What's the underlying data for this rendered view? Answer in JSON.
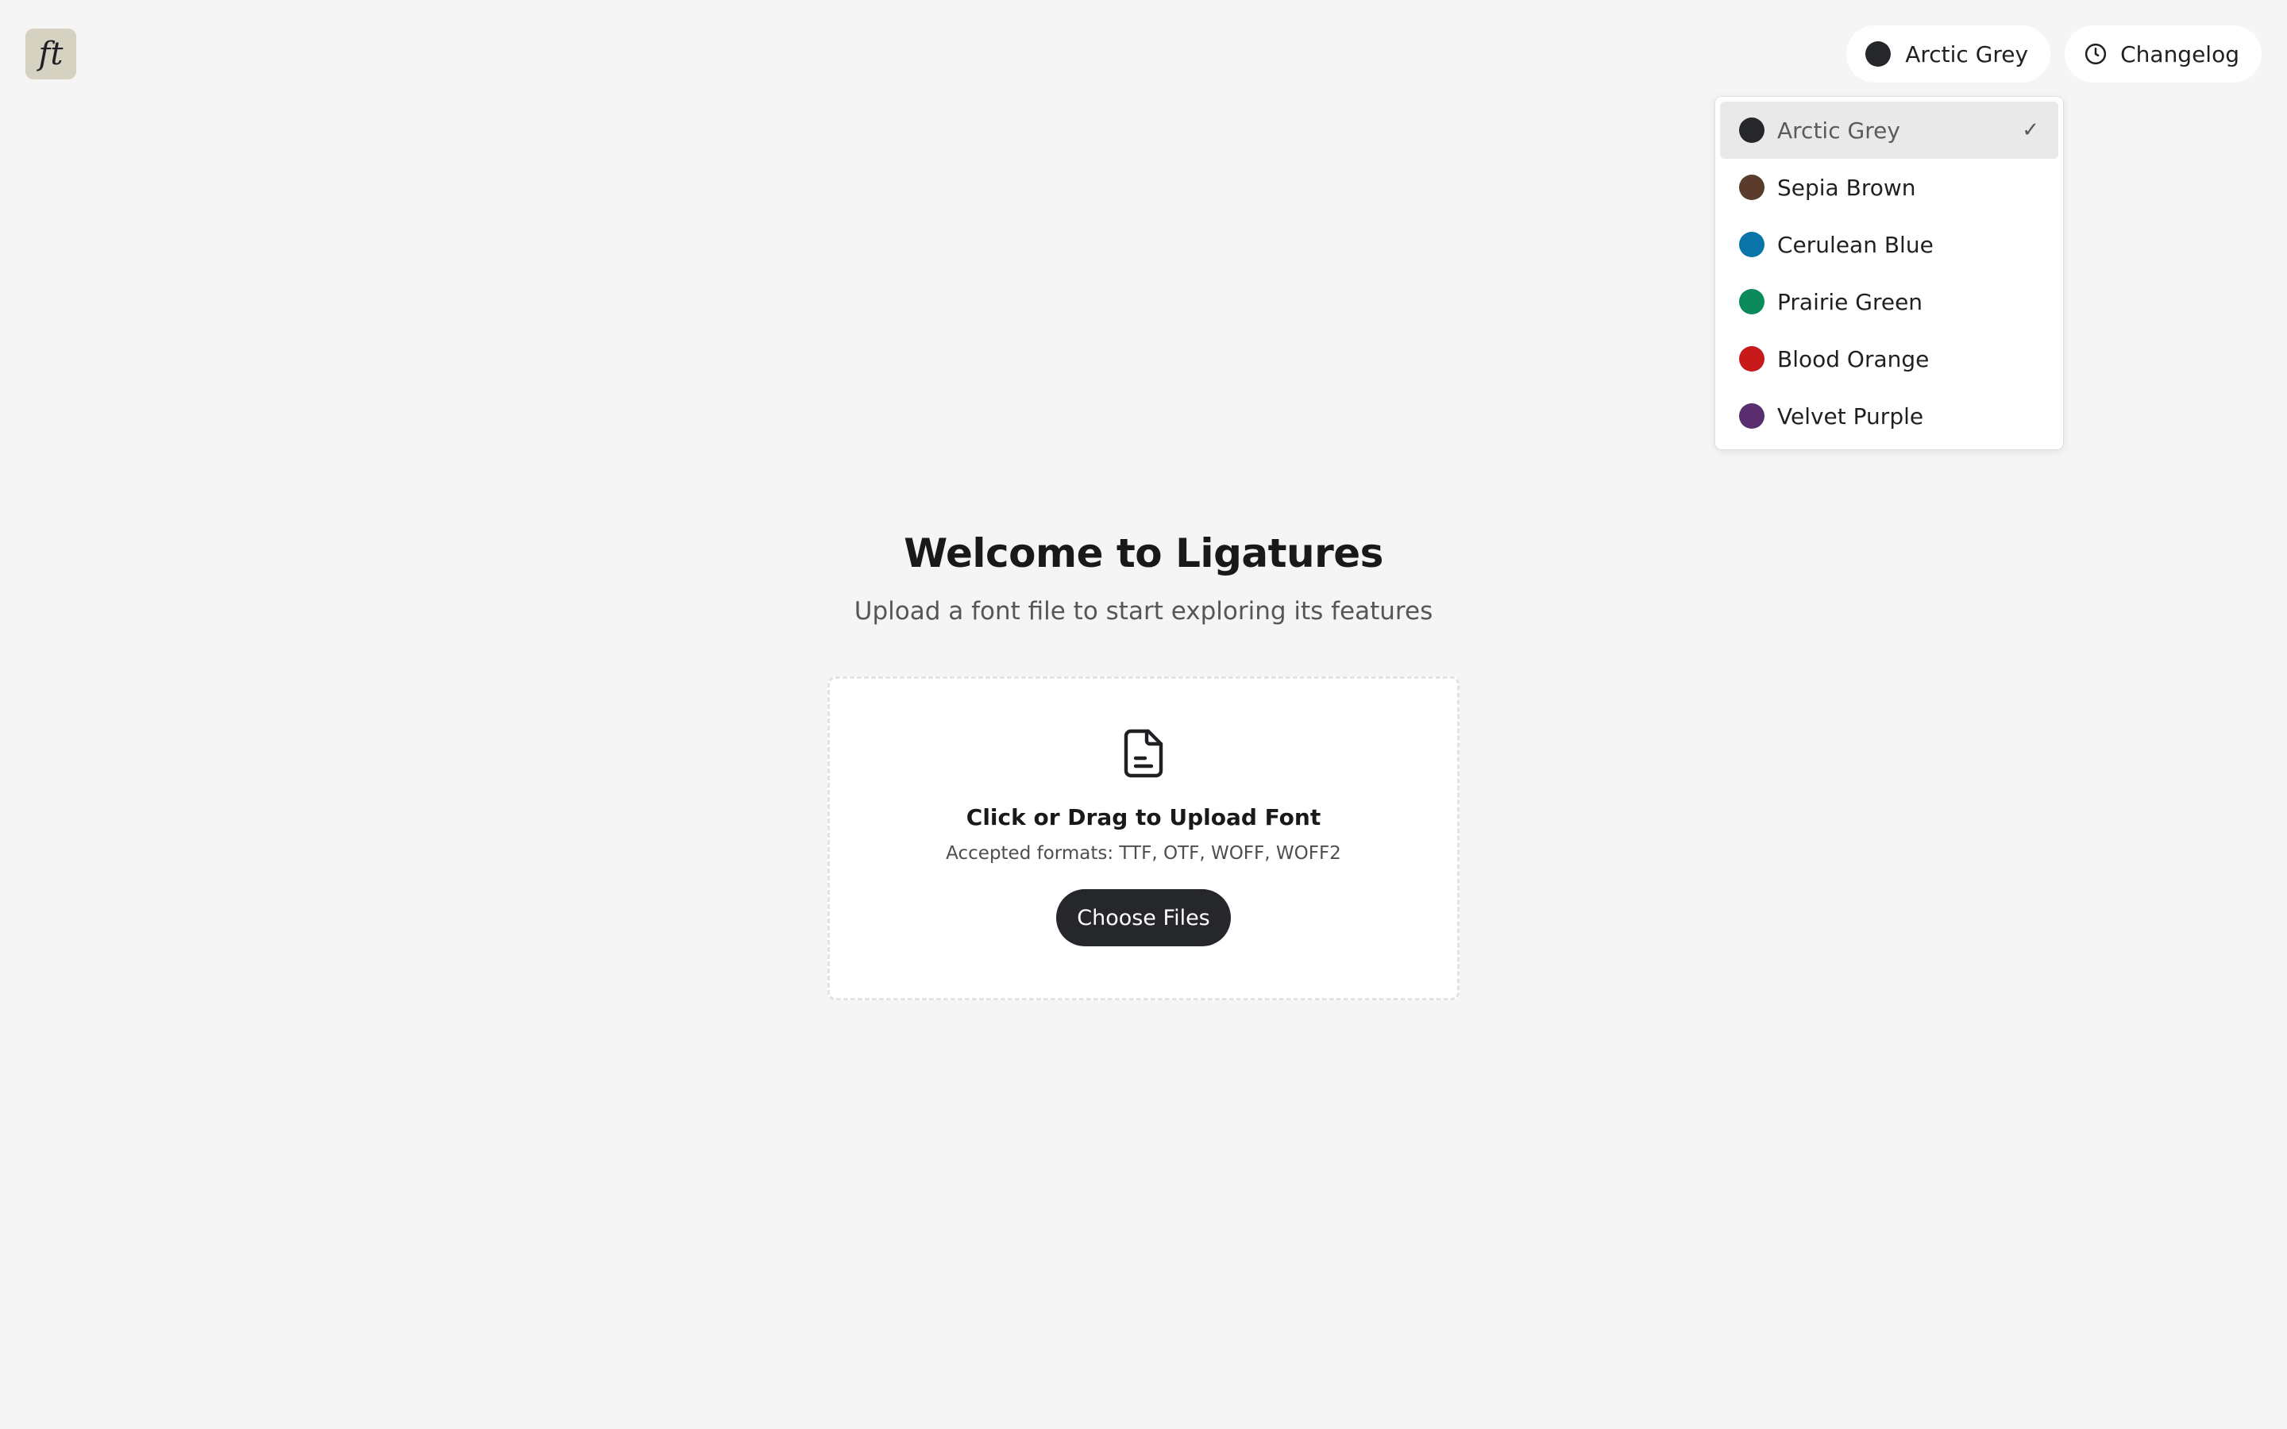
{
  "app": {
    "logo_text": "ft"
  },
  "header": {
    "theme_button_label": "Arctic Grey",
    "theme_button_color": "#26272a",
    "changelog_label": "Changelog"
  },
  "theme_menu": {
    "items": [
      {
        "label": "Arctic Grey",
        "color": "#26272a",
        "selected": true
      },
      {
        "label": "Sepia Brown",
        "color": "#5b3b2b",
        "selected": false
      },
      {
        "label": "Cerulean Blue",
        "color": "#0a74a8",
        "selected": false
      },
      {
        "label": "Prairie Green",
        "color": "#0b8a5b",
        "selected": false
      },
      {
        "label": "Blood Orange",
        "color": "#c81a1a",
        "selected": false
      },
      {
        "label": "Velvet Purple",
        "color": "#5a2d6e",
        "selected": false
      }
    ],
    "check_glyph": "✓"
  },
  "main": {
    "title": "Welcome to Ligatures",
    "subtitle": "Upload a font file to start exploring its features"
  },
  "upload": {
    "title": "Click or Drag to Upload Font",
    "formats": "Accepted formats: TTF, OTF, WOFF, WOFF2",
    "button_label": "Choose Files",
    "icon": "file-text-icon"
  }
}
